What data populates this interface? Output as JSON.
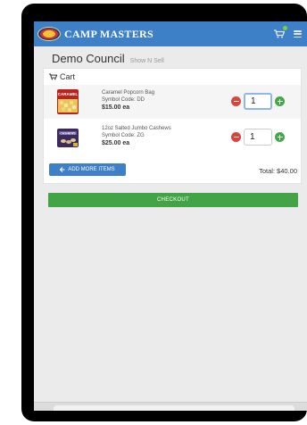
{
  "navbar": {
    "brand_name": "CAMP MASTERS",
    "icons": [
      "cart-icon",
      "menu-icon"
    ],
    "color": "#3d80c8"
  },
  "council": {
    "title": "Demo Council",
    "subtitle": "Show N Sell"
  },
  "cart": {
    "header": "Cart",
    "items": [
      {
        "name": "Caramel Popcorn Bag",
        "code": "Symbol Code: DD",
        "price": "$15.00 ea",
        "quantity": "1",
        "thumb_label": "CARAMEL"
      },
      {
        "name": "12oz Salted Jumbo Cashews",
        "code": "Symbol Code: ZG",
        "price": "$25.00 ea",
        "quantity": "1",
        "thumb_label": "CASHEWS"
      }
    ],
    "add_more_label": "ADD MORE ITEMS",
    "total_label": "Total:",
    "total_value": "$40.00"
  },
  "checkout": {
    "label": "CHECKOUT",
    "color": "#43a447"
  }
}
